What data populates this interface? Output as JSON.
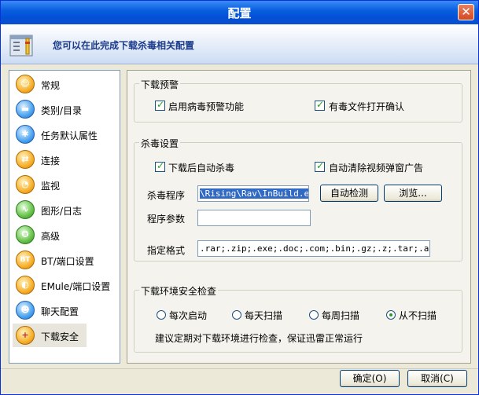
{
  "window": {
    "title": "配置",
    "close_label": "✕"
  },
  "header": {
    "text": "您可以在此完成下载杀毒相关配置"
  },
  "sidebar": {
    "items": [
      {
        "label": "常规",
        "glyph": "☺"
      },
      {
        "label": "类别/目录",
        "glyph": "▬"
      },
      {
        "label": "任务默认属性",
        "glyph": "✱"
      },
      {
        "label": "连接",
        "glyph": "⇄"
      },
      {
        "label": "监视",
        "glyph": "◔"
      },
      {
        "label": "图形/日志",
        "glyph": "∿"
      },
      {
        "label": "高级",
        "glyph": "✪"
      },
      {
        "label": "BT/端口设置",
        "glyph": "BT"
      },
      {
        "label": "EMule/端口设置",
        "glyph": "◐"
      },
      {
        "label": "聊天配置",
        "glyph": "☻"
      },
      {
        "label": "下载安全",
        "glyph": "+"
      }
    ],
    "selected": "下载安全"
  },
  "warning_group": {
    "title": "下载预警",
    "enable_label": "启用病毒预警功能",
    "confirm_label": "有毒文件打开确认"
  },
  "av_group": {
    "title": "杀毒设置",
    "auto_scan_label": "下载后自动杀毒",
    "auto_clear_label": "自动清除视频弹窗广告",
    "program_label": "杀毒程序",
    "program_value": "\\Rising\\Rav\\InBuild.exe",
    "detect_button": "自动检测",
    "browse_button": "浏览...",
    "params_label": "程序参数",
    "params_value": "",
    "formats_label": "指定格式",
    "formats_value": ".rar;.zip;.exe;.doc;.com;.bin;.gz;.z;.tar;.arj;.l"
  },
  "env_group": {
    "title": "下载环境安全检查",
    "options": [
      "每次启动",
      "每天扫描",
      "每周扫描",
      "从不扫描"
    ],
    "selected": "从不扫描",
    "note": "建议定期对下载环境进行检查，保证迅雷正常运行"
  },
  "footer": {
    "ok_label": "确定(O)",
    "cancel_label": "取消(C)"
  }
}
